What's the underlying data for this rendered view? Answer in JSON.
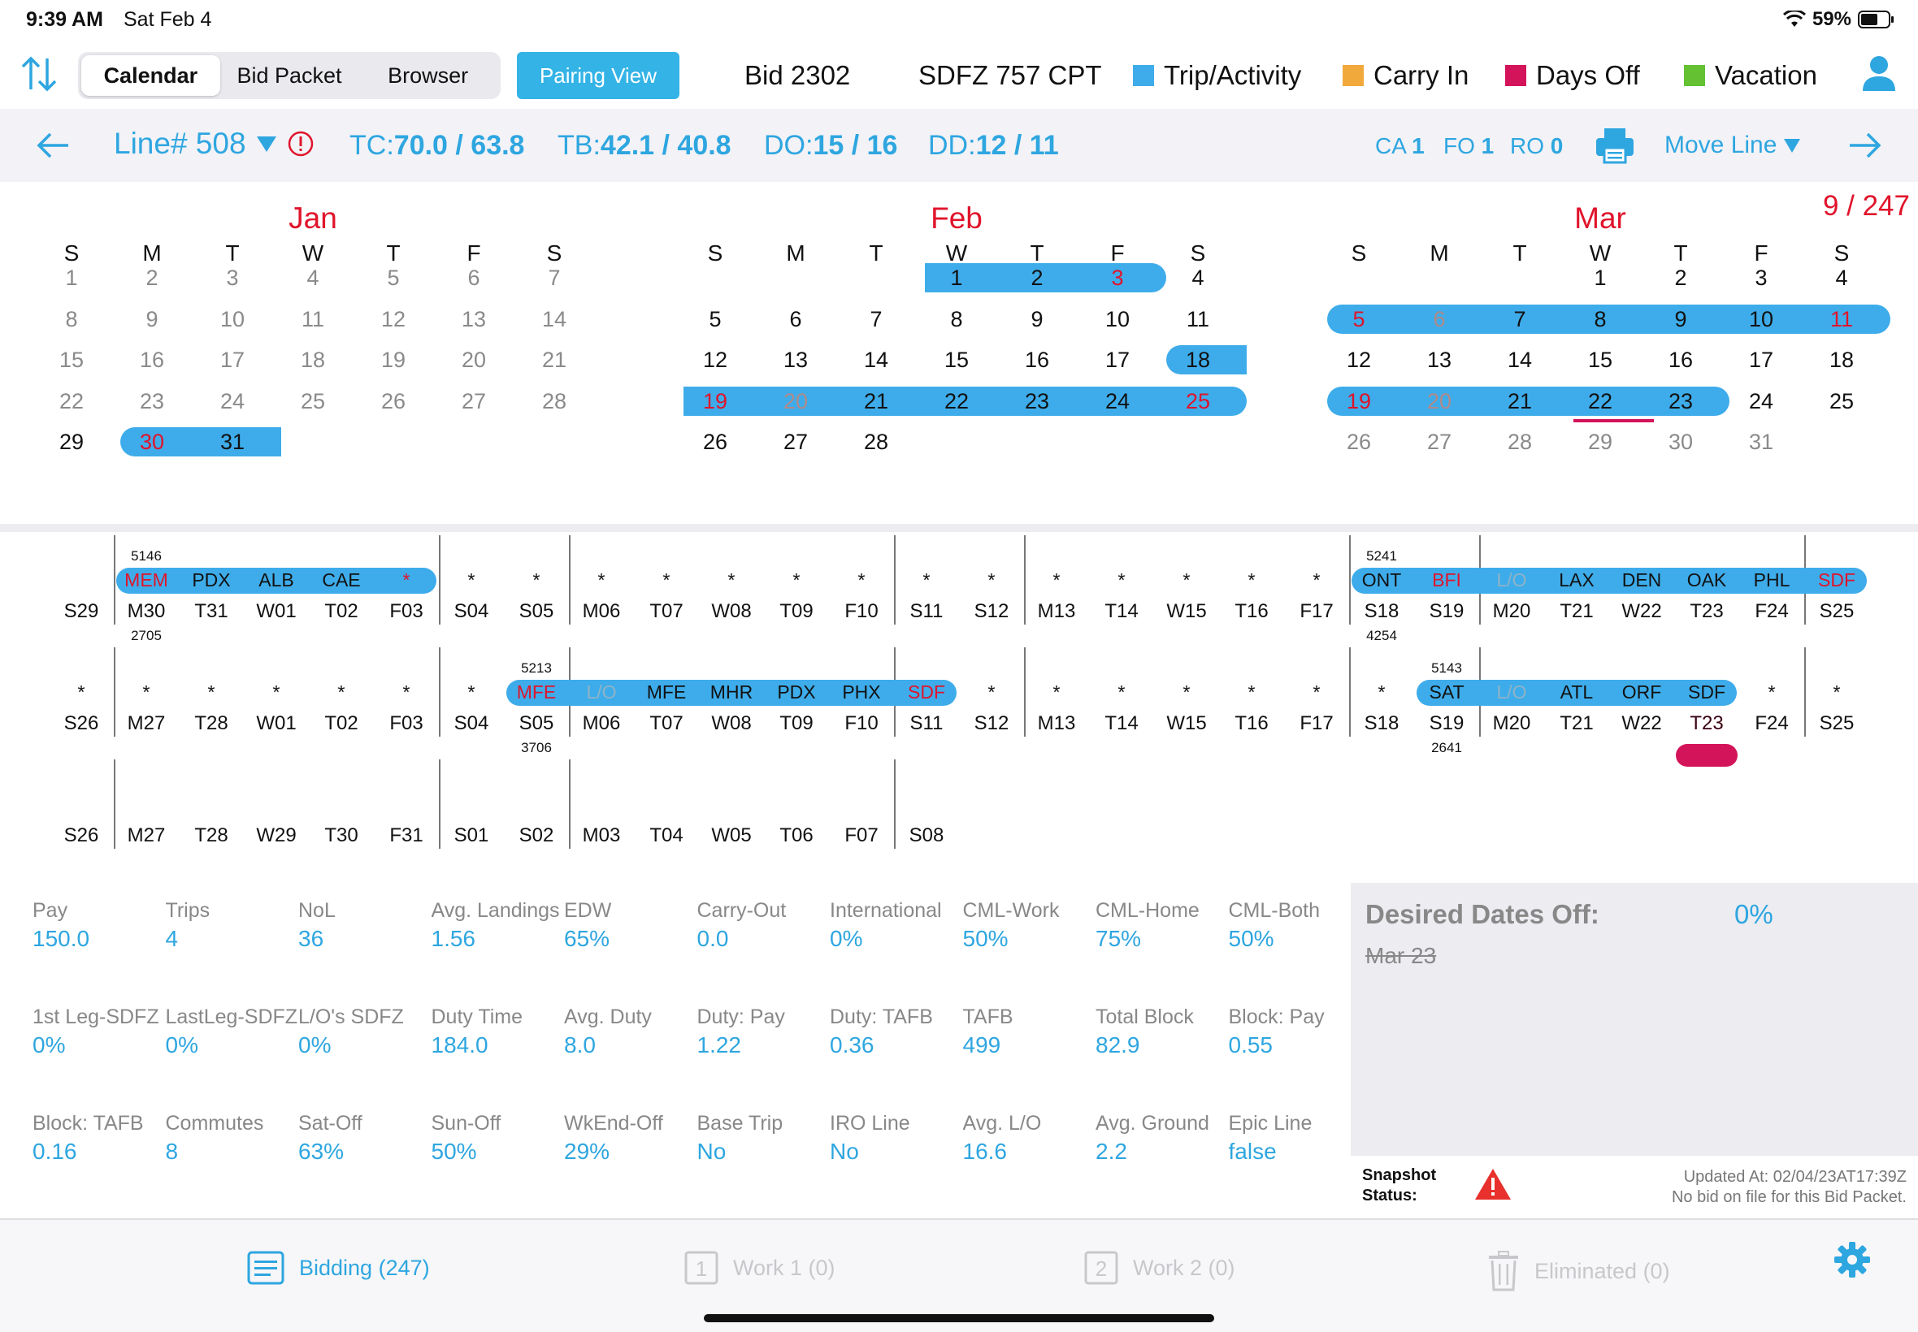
{
  "status": {
    "time": "9:39 AM",
    "date": "Sat Feb 4",
    "battery": "59%"
  },
  "topbar": {
    "segments": [
      "Calendar",
      "Bid Packet",
      "Browser"
    ],
    "pairing_view": "Pairing View",
    "bid": "Bid 2302",
    "position": "SDFZ 757 CPT",
    "legend": [
      {
        "label": "Trip/Activity",
        "color": "#3eacea"
      },
      {
        "label": "Carry In",
        "color": "#f2a93b"
      },
      {
        "label": "Days Off",
        "color": "#d4145a"
      },
      {
        "label": "Vacation",
        "color": "#63c132"
      }
    ]
  },
  "linebar": {
    "line": "Line# 508",
    "tc_label": "TC:",
    "tc_value": "70.0 / 63.8",
    "tb_label": "TB:",
    "tb_value": "42.1 / 40.8",
    "do_label": "DO:",
    "do_value": "15 / 16",
    "dd_label": "DD:",
    "dd_value": "12 / 11",
    "ca_label": "CA",
    "ca_value": "1",
    "fo_label": "FO",
    "fo_value": "1",
    "ro_label": "RO",
    "ro_value": "0",
    "move_line": "Move Line"
  },
  "calendar": {
    "rank": "9 / 247",
    "dow": [
      "S",
      "M",
      "T",
      "W",
      "T",
      "F",
      "S"
    ],
    "months": [
      {
        "name": "Jan",
        "start": 0,
        "days": 31
      },
      {
        "name": "Feb",
        "start": 3,
        "days": 28
      },
      {
        "name": "Mar",
        "start": 3,
        "days": 31
      }
    ]
  },
  "grid": {
    "rows": [
      {
        "days": [
          "S29",
          "M30",
          "T31",
          "W01",
          "T02",
          "F03",
          "S04",
          "S05",
          "M06",
          "T07",
          "W08",
          "T09",
          "F10",
          "S11",
          "S12",
          "M13",
          "T14",
          "W15",
          "T16",
          "F17",
          "S18",
          "S19",
          "M20",
          "T21",
          "W22",
          "T23",
          "F24",
          "S25"
        ],
        "airports": [
          "",
          "MEM",
          "PDX",
          "ALB",
          "CAE",
          "*",
          "*",
          "*",
          "*",
          "*",
          "*",
          "*",
          "*",
          "*",
          "*",
          "*",
          "*",
          "*",
          "*",
          "*",
          "ONT",
          "BFI",
          "L/O",
          "LAX",
          "DEN",
          "OAK",
          "PHL",
          "SDF"
        ],
        "trips_above": [
          {
            "col": 1,
            "label": "5146"
          },
          {
            "col": 20,
            "label": "5241"
          }
        ],
        "trips_below": [
          {
            "col": 1,
            "label": "2705"
          },
          {
            "col": 20,
            "label": "4254"
          }
        ]
      },
      {
        "days": [
          "S26",
          "M27",
          "T28",
          "W01",
          "T02",
          "F03",
          "S04",
          "S05",
          "M06",
          "T07",
          "W08",
          "T09",
          "F10",
          "S11",
          "S12",
          "M13",
          "T14",
          "W15",
          "T16",
          "F17",
          "S18",
          "S19",
          "M20",
          "T21",
          "W22",
          "T23",
          "F24",
          "S25"
        ],
        "airports": [
          "*",
          "*",
          "*",
          "*",
          "*",
          "*",
          "*",
          "MFE",
          "L/O",
          "MFE",
          "MHR",
          "PDX",
          "PHX",
          "SDF",
          "*",
          "*",
          "*",
          "*",
          "*",
          "*",
          "*",
          "SAT",
          "L/O",
          "ATL",
          "ORF",
          "SDF",
          "*",
          "*"
        ],
        "trips_above": [
          {
            "col": 7,
            "label": "5213"
          },
          {
            "col": 21,
            "label": "5143"
          }
        ],
        "trips_below": [
          {
            "col": 7,
            "label": "3706"
          },
          {
            "col": 21,
            "label": "2641"
          }
        ]
      },
      {
        "days": [
          "S26",
          "M27",
          "T28",
          "W29",
          "T30",
          "F31",
          "S01",
          "S02",
          "M03",
          "T04",
          "W05",
          "T06",
          "F07",
          "S08"
        ],
        "airports": [],
        "trips_above": [],
        "trips_below": []
      }
    ]
  },
  "stats": [
    {
      "label": "Pay",
      "value": "150.0"
    },
    {
      "label": "Trips",
      "value": "4"
    },
    {
      "label": "NoL",
      "value": "36"
    },
    {
      "label": "Avg. Landings",
      "value": "1.56"
    },
    {
      "label": "EDW",
      "value": "65%"
    },
    {
      "label": "Carry-Out",
      "value": "0.0"
    },
    {
      "label": "International",
      "value": "0%"
    },
    {
      "label": "CML-Work",
      "value": "50%"
    },
    {
      "label": "CML-Home",
      "value": "75%"
    },
    {
      "label": "CML-Both",
      "value": "50%"
    },
    {
      "label": "1st Leg-SDFZ",
      "value": "0%"
    },
    {
      "label": "LastLeg-SDFZ",
      "value": "0%"
    },
    {
      "label": "L/O's SDFZ",
      "value": "0%"
    },
    {
      "label": "Duty Time",
      "value": "184.0"
    },
    {
      "label": "Avg. Duty",
      "value": "8.0"
    },
    {
      "label": "Duty: Pay",
      "value": "1.22"
    },
    {
      "label": "Duty: TAFB",
      "value": "0.36"
    },
    {
      "label": "TAFB",
      "value": "499"
    },
    {
      "label": "Total Block",
      "value": "82.9"
    },
    {
      "label": "Block: Pay",
      "value": "0.55"
    },
    {
      "label": "Block: TAFB",
      "value": "0.16"
    },
    {
      "label": "Commutes",
      "value": "8"
    },
    {
      "label": "Sat-Off",
      "value": "63%"
    },
    {
      "label": "Sun-Off",
      "value": "50%"
    },
    {
      "label": "WkEnd-Off",
      "value": "29%"
    },
    {
      "label": "Base Trip",
      "value": "No"
    },
    {
      "label": "IRO Line",
      "value": "No"
    },
    {
      "label": "Avg. L/O",
      "value": "16.6"
    },
    {
      "label": "Avg. Ground",
      "value": "2.2"
    },
    {
      "label": "Epic Line",
      "value": "false"
    }
  ],
  "desired": {
    "title": "Desired Dates Off:",
    "percent": "0%",
    "date": "Mar 23"
  },
  "snapshot": {
    "label1": "Snapshot",
    "label2": "Status:",
    "updated": "Updated At: 02/04/23AT17:39Z",
    "note": "No bid on file for this Bid Packet."
  },
  "bottom": {
    "bidding": "Bidding (247)",
    "work1": "Work 1 (0)",
    "work2": "Work 2 (0)",
    "eliminated": "Eliminated (0)"
  }
}
